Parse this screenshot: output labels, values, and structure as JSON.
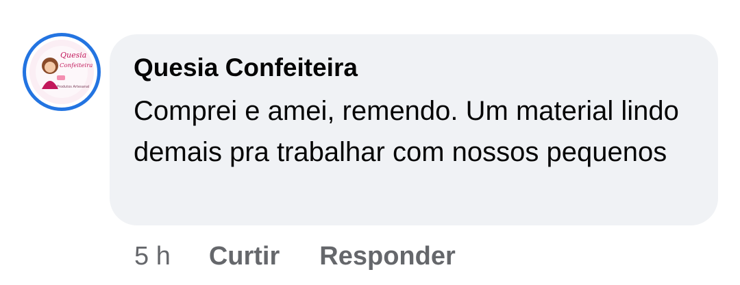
{
  "comment": {
    "author": "Quesia Confeiteira",
    "text": "Comprei e amei, remendo. Um material lindo demais pra trabalhar com nossos pequenos",
    "avatar_logo": {
      "title": "Quesia",
      "subtitle": "Confeiteira",
      "tagline": "Produtos Artesanal"
    }
  },
  "actions": {
    "time": "5 h",
    "like_label": "Curtir",
    "reply_label": "Responder"
  },
  "colors": {
    "bubble": "#f0f2f5",
    "story_ring": "#2374e1",
    "text": "#050505",
    "secondary": "#65676b"
  }
}
